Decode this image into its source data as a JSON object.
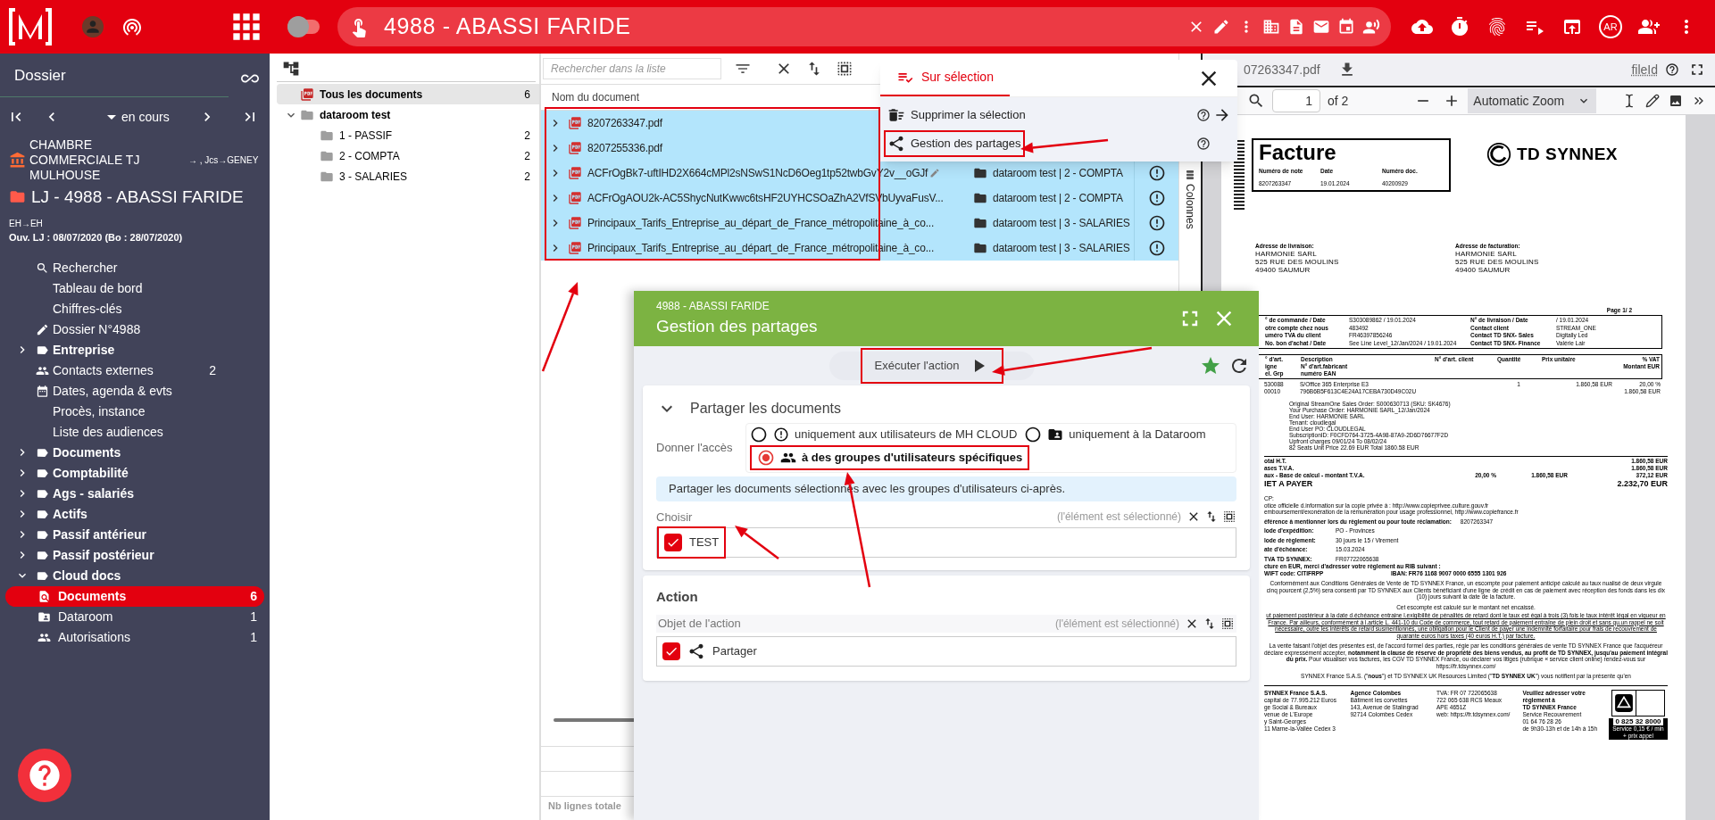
{
  "topbar": {
    "title": "4988 - ABASSI FARIDE",
    "user_initials": "AR",
    "toggle_on": false
  },
  "sidebar": {
    "title": "Dossier",
    "status": "en cours",
    "court": "CHAMBRE COMMERCIALE TJ MULHOUSE",
    "route": "→ , Jcs→GENEY",
    "case": "LJ - 4988 - ABASSI FARIDE",
    "sub": "EH→EH",
    "opening": "Ouv. LJ : 08/07/2020 (Bo : 28/07/2020)",
    "items": [
      {
        "kind": "search",
        "label": "Rechercher"
      },
      {
        "kind": "plain",
        "label": "Tableau de bord"
      },
      {
        "kind": "plain",
        "label": "Chiffres-clés"
      },
      {
        "kind": "edit",
        "label": "Dossier N°4988"
      },
      {
        "kind": "section",
        "label": "Entreprise",
        "expanded": false
      },
      {
        "kind": "people",
        "label": "Contacts externes",
        "count": "2"
      },
      {
        "kind": "calendar",
        "label": "Dates, agenda & evts"
      },
      {
        "kind": "plain",
        "label": "Procès, instance"
      },
      {
        "kind": "plain",
        "label": "Liste des audiences"
      },
      {
        "kind": "section",
        "label": "Documents",
        "expanded": false
      },
      {
        "kind": "section",
        "label": "Comptabilité",
        "expanded": false
      },
      {
        "kind": "section",
        "label": "Ags - salariés",
        "expanded": false
      },
      {
        "kind": "section",
        "label": "Actifs",
        "expanded": false
      },
      {
        "kind": "section",
        "label": "Passif antérieur",
        "expanded": false
      },
      {
        "kind": "section",
        "label": "Passif postérieur",
        "expanded": false
      },
      {
        "kind": "section",
        "label": "Cloud docs",
        "expanded": true,
        "children": [
          {
            "kind": "documents",
            "label": "Documents",
            "count": "6",
            "selected": true
          },
          {
            "kind": "dataroom",
            "label": "Dataroom",
            "count": "1",
            "selected": false
          },
          {
            "kind": "people",
            "label": "Autorisations",
            "count": "1",
            "selected": false
          }
        ]
      }
    ]
  },
  "tree": {
    "items": [
      {
        "kind": "all",
        "label": "Tous les documents",
        "count": "6",
        "selected": true
      },
      {
        "kind": "folder",
        "label": "dataroom test",
        "expanded": true,
        "selected": false,
        "children": [
          {
            "kind": "folder",
            "label": "1 - PASSIF",
            "count": "2",
            "selected": false
          },
          {
            "kind": "folder",
            "label": "2 - COMPTA",
            "count": "2",
            "selected": false
          },
          {
            "kind": "folder",
            "label": "3 - SALARIES",
            "count": "2",
            "selected": false
          }
        ]
      }
    ]
  },
  "list": {
    "search": {
      "placeholder": "Rechercher dans la liste"
    },
    "column": "Nom du document",
    "side_tab": "Colonnes",
    "footer": "Nb lignes totale",
    "rows": [
      {
        "name": "8207263347.pdf",
        "selected": true
      },
      {
        "name": "8207255336.pdf",
        "selected": true
      },
      {
        "name": "ACFrOgBk7-uftIHD2X664cMPl2sNSwS1NcD6Oeg1tp52twbGvY2v__oGJf",
        "folder": "dataroom test | 2 - COMPTA",
        "warning": true,
        "editing": true,
        "selected": true
      },
      {
        "name": "ACFrOgAOU2k-AC5ShycNutKwwc6tsHF2UYHCSOaZhA2VfSVbUyvaFusV...",
        "folder": "dataroom test | 2 - COMPTA",
        "warning": true,
        "selected": true
      },
      {
        "name": "Principaux_Tarifs_Entreprise_au_départ_de_France_métropolitaine_à_co...",
        "folder": "dataroom test | 3 - SALARIES",
        "warning": true,
        "selected": true
      },
      {
        "name": "Principaux_Tarifs_Entreprise_au_départ_de_France_métropolitaine_à_co...",
        "folder": "dataroom test | 3 - SALARIES",
        "warning": true,
        "selected": true
      }
    ]
  },
  "selection_menu": {
    "tab": {
      "label": "Sur sélection",
      "selected": true
    },
    "items": [
      {
        "kind": "delete",
        "label": "Supprimer la sélection",
        "arrow": true
      },
      {
        "kind": "share",
        "label": "Gestion des partages",
        "arrow": false
      }
    ]
  },
  "viewer": {
    "filename": "07263347.pdf",
    "link": "fileId",
    "page": "1",
    "page_count": "of 2",
    "zoom": "Automatic Zoom"
  },
  "invoice": {
    "title": "Facture",
    "fields": [
      {
        "label": "Numéro de note",
        "value": "8207263347"
      },
      {
        "label": "Date",
        "value": "19.01.2024"
      },
      {
        "label": "Numéro doc.",
        "value": "40200929"
      }
    ],
    "brand": "TD SYNNEX",
    "addresses": [
      {
        "label": "Adresse de livraison:",
        "lines": [
          "HARMONIE SARL",
          "525 RUE DES MOULINS",
          "49400 SAUMUR"
        ]
      },
      {
        "label": "Adresse de facturation:",
        "lines": [
          "HARMONIE SARL",
          "525 RUE DES MOULINS",
          "49400 SAUMUR"
        ]
      }
    ],
    "page": "Page 1/ 2",
    "order_rows": [
      [
        "° de commande / Date",
        "S303089862 / 19.01.2024",
        "N° de livraison / Date",
        "/ 19.01.2024"
      ],
      [
        "otre compte chez nous",
        "483492",
        "Contact client",
        "STREAM_ONE"
      ],
      [
        "uméro TVA du client",
        "FR46397856246",
        "Contact TD SNX- Sales",
        "Digitally Led"
      ],
      [
        "No. bon d'achat / Date",
        "See Line Level_12/Jan/2024 / 19.01.2024",
        "Contact TD SNX- Finance",
        "Valérie Lair"
      ]
    ],
    "item_headers": [
      [
        "° d'art.",
        "igne",
        "el. Grp"
      ],
      [
        "Description",
        "N° d'art.fabricant",
        "numéro EAN"
      ],
      [
        "N° d'art. client"
      ],
      [
        "Quantité"
      ],
      [
        "Prix unitaire"
      ],
      [
        "% VAT",
        "Montant EUR"
      ]
    ],
    "item": {
      "ref": [
        "530088",
        "00010"
      ],
      "description": [
        "S/Office 365 Enterprise E3",
        "796B6B5F613C4E24A17CEBA730D49C02U"
      ],
      "quantity": "1",
      "unit_price": "1.860,58 EUR",
      "amount": [
        "20,00 %",
        "1.860,58 EUR"
      ]
    },
    "notes": [
      "Original StreamOne Sales Order: S000630713 (SKU: SK4676)",
      "Your Purchase Order: HARMONIE SARL_12/Jan/2024",
      "End User: HARMONIE SARL",
      "Tenant: cloudlegal",
      "End User PO: CLOUDLEGAL",
      "SubscriptionID: F0CFD764-3725-4A98-87A9-2D6D76677F2D",
      "Upfront charges 09/01/24 To 08/02/24",
      "82 Seats Unit Price 22.69 EUR Total 1860.58 EUR"
    ],
    "totals": [
      {
        "kind": "line",
        "label": "otal H.T.",
        "amount": "1.860,58 EUR"
      },
      {
        "kind": "line",
        "label": "ases T.V.A.",
        "amount": "1.860,58 EUR"
      },
      {
        "kind": "line",
        "label": "aux - Base de calcul - montant T.V.A.",
        "rate": "20,00 %",
        "base": "1.860,58 EUR",
        "amount": "372,12 EUR"
      },
      {
        "kind": "grand",
        "label": "IET A PAYER",
        "amount": "2.232,70 EUR"
      }
    ],
    "legal": [
      {
        "kind": "text",
        "text": "CP:"
      },
      {
        "kind": "text",
        "text": "otice officielle d.information sur la copie privée à : http://www.copieprivee.culture.gouv.fr"
      },
      {
        "kind": "text",
        "text": "emboursement/exonération de la rémunération pour usage professionnel, http://www.copiefrance.fr"
      },
      {
        "kind": "pair",
        "label": "éférence à mentionner lors du règlement ou pour toute réclamation:",
        "value": "8207263347"
      },
      {
        "kind": "pair",
        "label": "lode d'expédition:",
        "value": "PO - Provinces"
      },
      {
        "kind": "pair",
        "label": "lode de règlement:",
        "value": "30 jours le 15 / Virement"
      },
      {
        "kind": "pair",
        "label": "ate d'échéance:",
        "value": "15.03.2024"
      },
      {
        "kind": "pair",
        "label": "TVA TD SYNNEX:",
        "value": "FR07722065638"
      },
      {
        "kind": "bold",
        "text": "cture en EUR, merci d'adresser votre règlement au RIB suivant :"
      },
      {
        "kind": "bold_pair",
        "label": "WIFT code: CITIFRPP",
        "value": "IBAN: FR76 1168 9007 0000 6555 1301 926"
      },
      {
        "kind": "paragraph",
        "text": "Conformément aux Conditions Générales de Vente de TD SYNNEX France, un escompte pour paiement anticipé calculé au taux nualisé de deux virgule cinq pourcent (2,5%) sera consenti par TD SYNNEX aux Clients bénéficiant d'une ligne de crédit en cas de paiement avec réception des fonds dans les dix (10) jours suivant la date de la facture."
      },
      {
        "kind": "paragraph",
        "text": "Cet escompte est calculé sur le montant net encaissé."
      },
      {
        "kind": "underlined",
        "text": "ut paiement postérieur à la date d.échéance entraine l.exigibilité de pénalités de retard dont le taux est égal à trois (3) fois le taux intérêt légal en vigueur en France. Par ailleurs, conformément à l.article L. 441-10 du Code de commerce, tout retard de paiement entraîne de plein droit et sans qu.un rappel ne soit nécessaire, outre les intérêts de retard susmentionnés, une obligation pour le Client de payer une indemnité forfaitaire pour frais de recouvrement de quarante euros hors taxes (40 euros H.T.) par facture."
      },
      {
        "kind": "paragraph",
        "text": "La vente faisant l'objet des présentes est, de l'accord formel des parties, régie par les conditions générales de vente TD SYNNEX France que l'acquéreur déclare expressément accepter, **notamment la clause de réserve de propriété des biens vendus, au profit de TD SYNNEX, jusqu'au paiement intégral du prix.** Pour visualiser vos factures, les CGV TD SYNNEX France, ou déclarer vos litiges (rubrique « service client online) rendez-vous sur https://fr.tdsynnex.com/"
      },
      {
        "kind": "paragraph",
        "text": "SYNNEX France S.A.S. (\"**nous**\") et TD SYNNEX UK Resources Limited (\"**TD SYNNEX UK**\") vous notifient par la présente qu'en"
      }
    ],
    "footer": [
      [
        {
          "text": "SYNNEX France S.A.S.",
          "bold": true
        },
        {
          "text": "capital de 77.995.212 Euros",
          "bold": false
        },
        {
          "text": "ge Social & Bureaux",
          "bold": false
        },
        {
          "text": "venue de L'Europe",
          "bold": false
        },
        {
          "text": "y Saint-Georges",
          "bold": false
        },
        {
          "text": "11 Marne-la-Vallée Cedex 3",
          "bold": false
        }
      ],
      [
        {
          "text": "Agence Colombes",
          "bold": true
        },
        {
          "text": "Bâtiment les corvettes",
          "bold": false
        },
        {
          "text": "143, Avenue de Stalingrad",
          "bold": false
        },
        {
          "text": "92714 Colombes Cedex",
          "bold": false
        }
      ],
      [
        {
          "text": "TVA: FR 07 722065638",
          "bold": false
        },
        {
          "text": "722 065 638 RCS Meaux",
          "bold": false
        },
        {
          "text": "APE 4651Z",
          "bold": false
        },
        {
          "text": "web: https://fr.tdsynnex.com/",
          "bold": false
        }
      ],
      [
        {
          "text": "Veuillez adresser votre règlement à",
          "bold": true
        },
        {
          "text": "TD SYNNEX France",
          "bold": true
        },
        {
          "text": "Service Recouvrement",
          "bold": false
        },
        {
          "text": "01 64 76 28 26",
          "bold": false
        },
        {
          "text": "de 9h30-13h et de 14h à 15h",
          "bold": false
        }
      ]
    ],
    "phone": "0 825 32 8000",
    "phone_note": "Service 0,15 € / min + prix appel"
  },
  "dialog": {
    "subtitle": "4988 - ABASSI FARIDE",
    "title": "Gestion des partages",
    "run": "Exécuter l'action",
    "share": {
      "title": "Partager les documents",
      "expanded": true,
      "access_label": "Donner l'accès",
      "options": [
        {
          "kind": "warning",
          "label": "uniquement aux utilisateurs de MH CLOUD",
          "selected": false
        },
        {
          "kind": "dataroom",
          "label": "uniquement à la Dataroom",
          "selected": false
        },
        {
          "kind": "groups",
          "label": "à des groupes d'utilisateurs spécifiques",
          "selected": true
        }
      ],
      "info": "Partager les documents sélectionnés avec les groupes d'utilisateurs ci-après.",
      "choose_label": "Choisir",
      "hint": "(l'élément est sélectionné)",
      "choices": [
        {
          "label": "TEST",
          "checked": true
        }
      ]
    },
    "action": {
      "title": "Action",
      "object_label": "Objet de l'action",
      "hint": "(l'élément est sélectionné)",
      "choices": [
        {
          "label": "Partager",
          "checked": true
        }
      ]
    }
  }
}
